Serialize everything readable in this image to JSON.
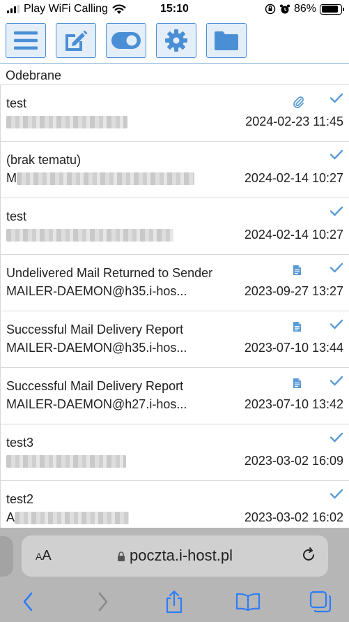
{
  "status_bar": {
    "carrier": "Play WiFi Calling",
    "time": "15:10",
    "battery": "86%",
    "battery_level": 0.86
  },
  "toolbar": {
    "buttons": [
      {
        "icon": "menu-icon"
      },
      {
        "icon": "compose-icon"
      },
      {
        "icon": "toggle-icon"
      },
      {
        "icon": "gear-icon"
      },
      {
        "icon": "folder-icon"
      }
    ],
    "accent_color": "#4a8fd6"
  },
  "folder": {
    "title": "Odebrane"
  },
  "messages": [
    {
      "subject": "test",
      "from": "",
      "date": "2024-02-23 11:45",
      "attachment": "paperclip-icon",
      "read": true
    },
    {
      "subject": "(brak tematu)",
      "from": "M",
      "date": "2024-02-14 10:27",
      "attachment": "",
      "read": true
    },
    {
      "subject": "test",
      "from": "",
      "date": "2024-02-14 10:27",
      "attachment": "",
      "read": true
    },
    {
      "subject": "Undelivered Mail Returned to Sender",
      "from": "MAILER-DAEMON@h35.i-hos...",
      "date": "2023-09-27 13:27",
      "attachment": "document-icon",
      "read": true
    },
    {
      "subject": "Successful Mail Delivery Report",
      "from": "MAILER-DAEMON@h35.i-hos...",
      "date": "2023-07-10 13:44",
      "attachment": "document-icon",
      "read": true
    },
    {
      "subject": "Successful Mail Delivery Report",
      "from": "MAILER-DAEMON@h27.i-hos...",
      "date": "2023-07-10 13:42",
      "attachment": "document-icon",
      "read": true
    },
    {
      "subject": "test3",
      "from": "",
      "date": "2023-03-02 16:09",
      "attachment": "",
      "read": true
    },
    {
      "subject": "test2",
      "from": "A",
      "date": "2023-03-02 16:02",
      "attachment": "",
      "read": true
    }
  ],
  "browser": {
    "text_size_label_small": "A",
    "text_size_label_large": "A",
    "url": "poczta.i-host.pl",
    "nav_icons": [
      "back-icon",
      "forward-icon",
      "share-icon",
      "bookmarks-icon",
      "tabs-icon"
    ],
    "tint_color": "#2f7cf6"
  }
}
